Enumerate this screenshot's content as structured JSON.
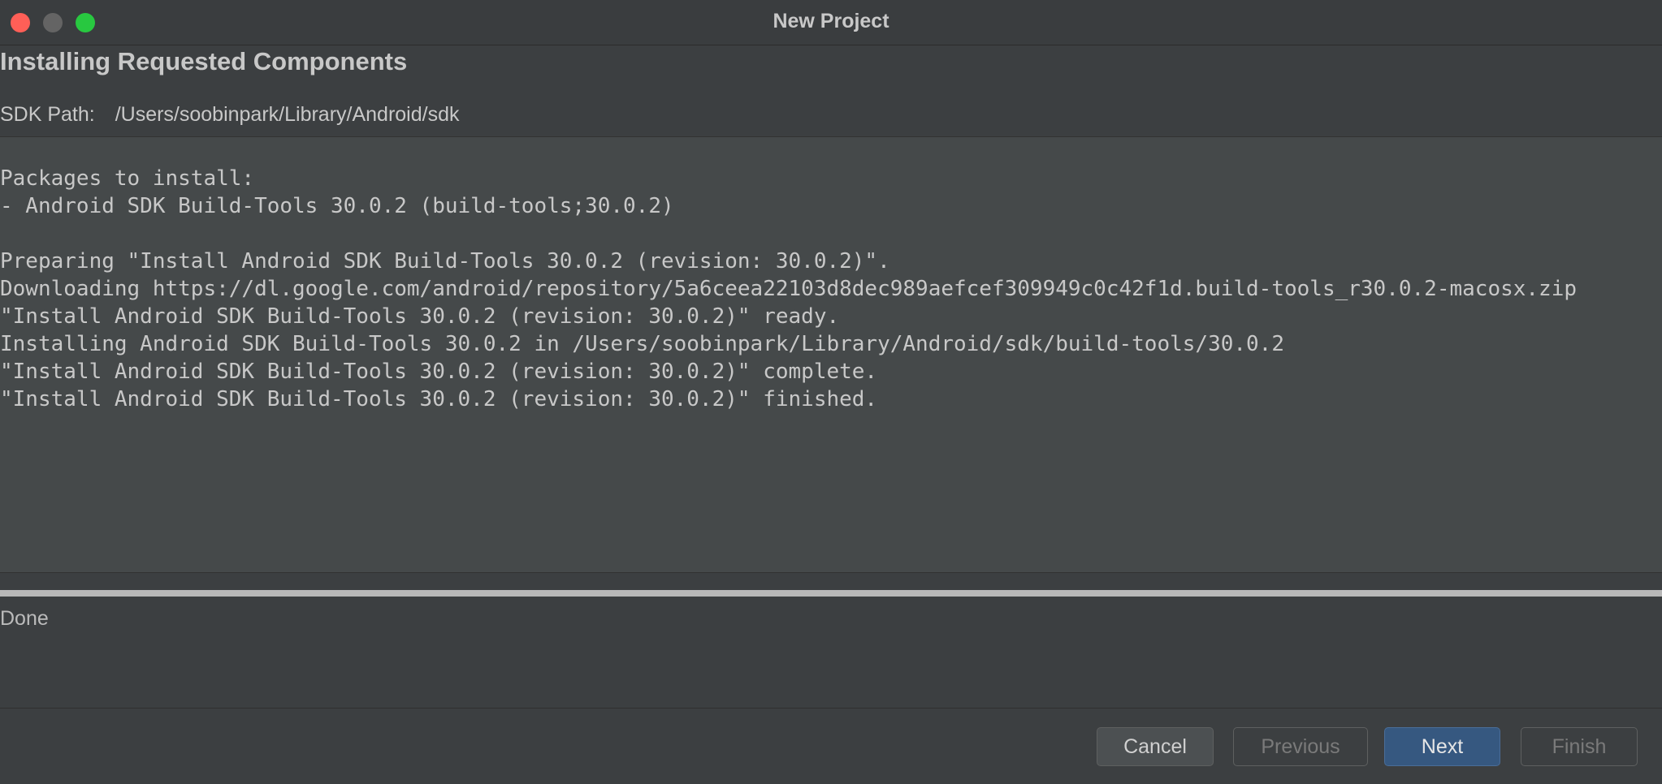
{
  "window": {
    "title": "New Project",
    "controls": {
      "close": "close-button",
      "minimize": "minimize-button",
      "zoom": "zoom-button"
    }
  },
  "page": {
    "heading": "Installing Requested Components",
    "sdk_path_label": "SDK Path:",
    "sdk_path_value": "/Users/soobinpark/Library/Android/sdk"
  },
  "log": {
    "lines": [
      "Packages to install:",
      "- Android SDK Build-Tools 30.0.2 (build-tools;30.0.2)",
      "",
      "Preparing \"Install Android SDK Build-Tools 30.0.2 (revision: 30.0.2)\".",
      "Downloading https://dl.google.com/android/repository/5a6ceea22103d8dec989aefcef309949c0c42f1d.build-tools_r30.0.2-macosx.zip",
      "\"Install Android SDK Build-Tools 30.0.2 (revision: 30.0.2)\" ready.",
      "Installing Android SDK Build-Tools 30.0.2 in /Users/soobinpark/Library/Android/sdk/build-tools/30.0.2",
      "\"Install Android SDK Build-Tools 30.0.2 (revision: 30.0.2)\" complete.",
      "\"Install Android SDK Build-Tools 30.0.2 (revision: 30.0.2)\" finished."
    ]
  },
  "progress": {
    "fraction": 1.0
  },
  "status": {
    "text": "Done"
  },
  "buttons": {
    "cancel": "Cancel",
    "previous": "Previous",
    "next": "Next",
    "finish": "Finish"
  },
  "colors": {
    "background": "#3c3f41",
    "log_background": "#45494a",
    "accent": "#365880",
    "close": "#ff5f57",
    "minimize": "#646464",
    "zoom": "#28c840"
  }
}
